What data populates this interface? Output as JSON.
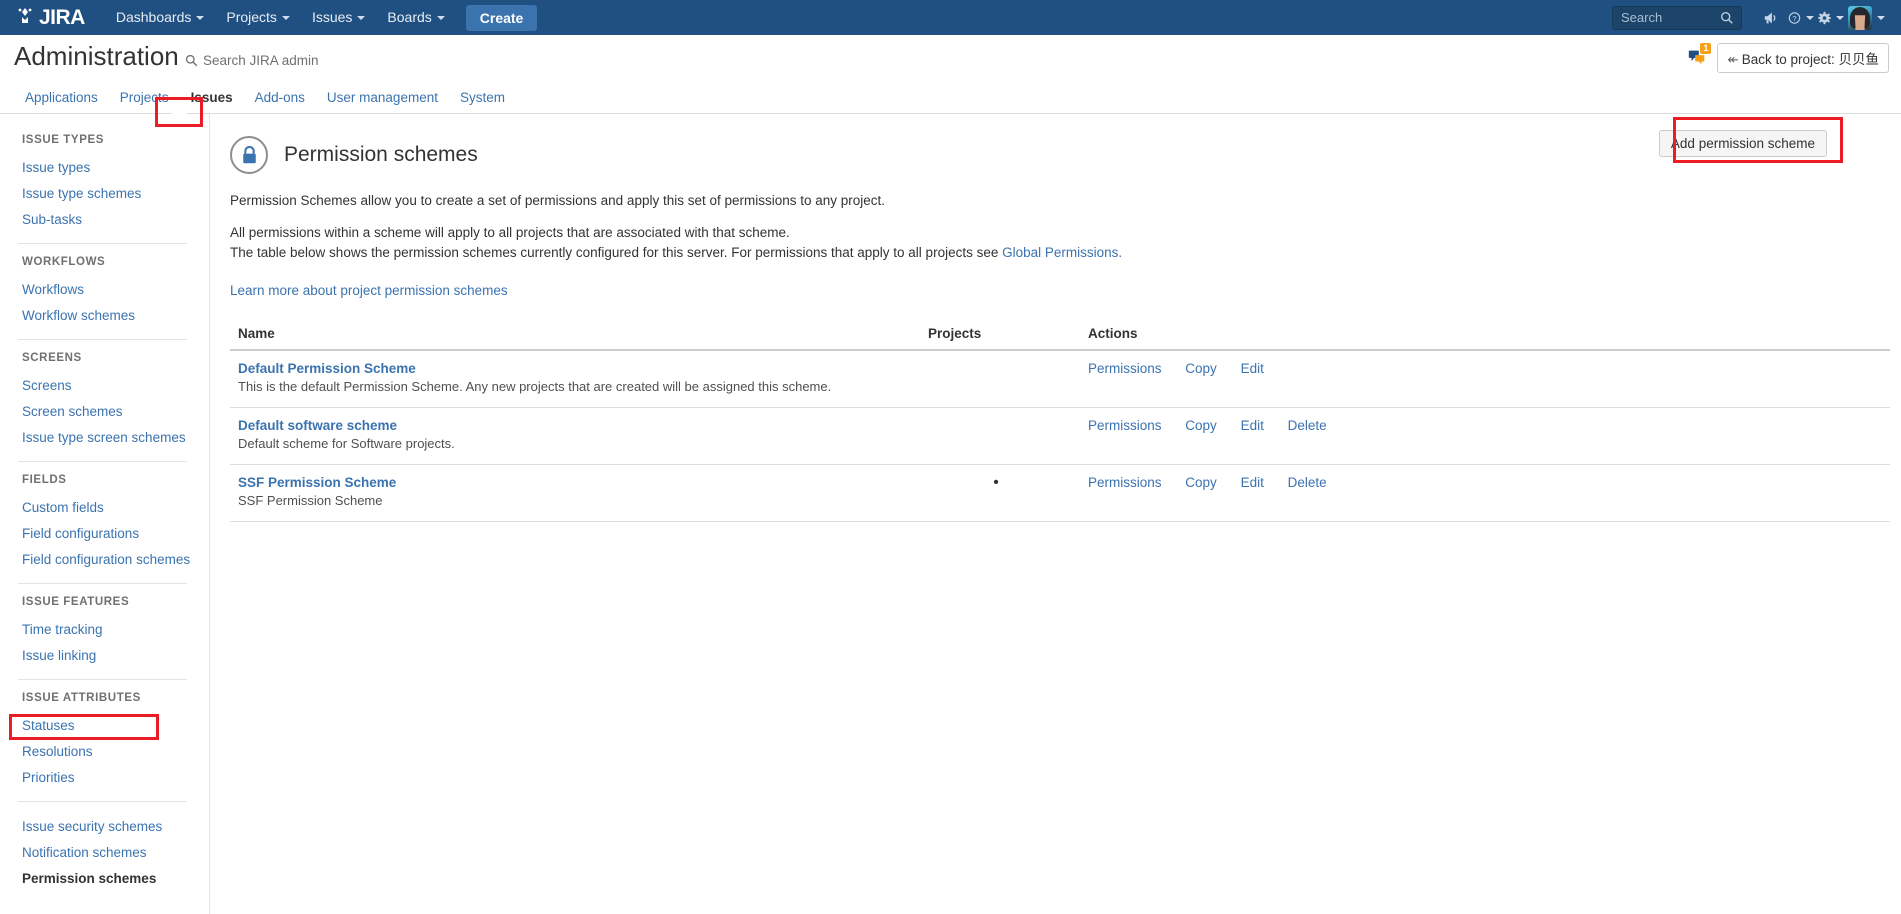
{
  "topbar": {
    "logo_text": "JIRA",
    "nav": [
      {
        "label": "Dashboards",
        "has_caret": true
      },
      {
        "label": "Projects",
        "has_caret": true
      },
      {
        "label": "Issues",
        "has_caret": true
      },
      {
        "label": "Boards",
        "has_caret": true
      }
    ],
    "create_label": "Create",
    "search_placeholder": "Search",
    "search_value": "",
    "icons": [
      "megaphone-icon",
      "help-icon",
      "settings-gear-icon",
      "avatar"
    ],
    "bg_color": "#205081",
    "create_color": "#3b73af"
  },
  "admin": {
    "title": "Administration",
    "search_label": "Search JIRA admin",
    "notification_count": "1",
    "back_to_project": "Back to project: 贝贝鱼",
    "back_arrow": "↞"
  },
  "tabs": [
    {
      "label": "Applications",
      "active": false
    },
    {
      "label": "Projects",
      "active": false
    },
    {
      "label": "Issues",
      "active": true
    },
    {
      "label": "Add-ons",
      "active": false
    },
    {
      "label": "User management",
      "active": false
    },
    {
      "label": "System",
      "active": false
    }
  ],
  "sidebar": {
    "groups": [
      {
        "title": "ISSUE TYPES",
        "items": [
          {
            "label": "Issue types",
            "active": false
          },
          {
            "label": "Issue type schemes",
            "active": false
          },
          {
            "label": "Sub-tasks",
            "active": false
          }
        ]
      },
      {
        "title": "WORKFLOWS",
        "items": [
          {
            "label": "Workflows",
            "active": false
          },
          {
            "label": "Workflow schemes",
            "active": false
          }
        ]
      },
      {
        "title": "SCREENS",
        "items": [
          {
            "label": "Screens",
            "active": false
          },
          {
            "label": "Screen schemes",
            "active": false
          },
          {
            "label": "Issue type screen schemes",
            "active": false
          }
        ]
      },
      {
        "title": "FIELDS",
        "items": [
          {
            "label": "Custom fields",
            "active": false
          },
          {
            "label": "Field configurations",
            "active": false
          },
          {
            "label": "Field configuration schemes",
            "active": false
          }
        ]
      },
      {
        "title": "ISSUE FEATURES",
        "items": [
          {
            "label": "Time tracking",
            "active": false
          },
          {
            "label": "Issue linking",
            "active": false
          }
        ]
      },
      {
        "title": "ISSUE ATTRIBUTES",
        "items": [
          {
            "label": "Statuses",
            "active": false
          },
          {
            "label": "Resolutions",
            "active": false
          },
          {
            "label": "Priorities",
            "active": false
          }
        ]
      },
      {
        "title": "",
        "items": [
          {
            "label": "Issue security schemes",
            "active": false
          },
          {
            "label": "Notification schemes",
            "active": false
          },
          {
            "label": "Permission schemes",
            "active": true
          }
        ]
      }
    ]
  },
  "page": {
    "icon": "lock-icon",
    "title": "Permission schemes",
    "paragraph_1": "Permission Schemes allow you to create a set of permissions and apply this set of permissions to any project.",
    "paragraph_2": "All permissions within a scheme will apply to all projects that are associated with that scheme.",
    "paragraph_3_prefix": "The table below shows the permission schemes currently configured for this server. For permissions that apply to all projects see ",
    "paragraph_3_link": "Global Permissions.",
    "learn_more": "Learn more about project permission schemes",
    "add_button": "Add permission scheme"
  },
  "table": {
    "headers": [
      "Name",
      "Projects",
      "Actions"
    ],
    "rows": [
      {
        "name": "Default Permission Scheme",
        "description": "This is the default Permission Scheme. Any new projects that are created will be assigned this scheme.",
        "projects": "",
        "actions": [
          "Permissions",
          "Copy",
          "Edit"
        ]
      },
      {
        "name": "Default software scheme",
        "description": "Default scheme for Software projects.",
        "projects": "",
        "actions": [
          "Permissions",
          "Copy",
          "Edit",
          "Delete"
        ]
      },
      {
        "name": "SSF Permission Scheme",
        "description": "SSF Permission Scheme",
        "projects": "•",
        "actions": [
          "Permissions",
          "Copy",
          "Edit",
          "Delete"
        ]
      }
    ]
  },
  "annotations": {
    "highlight_color": "#ec1c24",
    "boxes": [
      "issues-tab",
      "add-permission-scheme-button",
      "permission-schemes-sidebar-item"
    ]
  }
}
